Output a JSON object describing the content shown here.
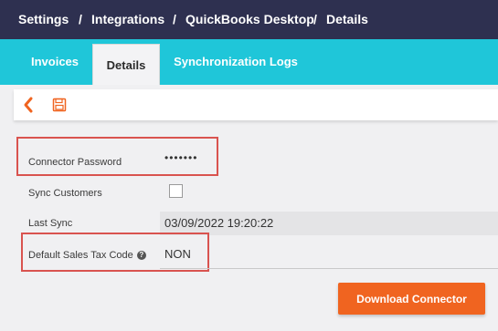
{
  "breadcrumb": {
    "items": [
      "Settings",
      "Integrations",
      "QuickBooks Desktop",
      "Details"
    ],
    "separator": "/"
  },
  "tabs": [
    {
      "label": "Invoices",
      "active": false
    },
    {
      "label": "Details",
      "active": true
    },
    {
      "label": "Synchronization Logs",
      "active": false
    }
  ],
  "toolbar": {
    "back_icon": "chevron-left-icon",
    "save_icon": "floppy-disk-icon"
  },
  "form": {
    "connector_password": {
      "label": "Connector Password",
      "value": "•••••••"
    },
    "sync_customers": {
      "label": "Sync Customers",
      "checked": false
    },
    "last_sync": {
      "label": "Last Sync",
      "value": "03/09/2022 19:20:22"
    },
    "default_sales_tax_code": {
      "label": "Default Sales Tax Code",
      "help_icon": "question-circle-icon",
      "value": "NON"
    }
  },
  "download_button": {
    "label": "Download Connector"
  },
  "colors": {
    "topbar": "#2e3050",
    "tabbar": "#1fc6d9",
    "accent": "#f06420",
    "highlight": "#d9534f"
  }
}
